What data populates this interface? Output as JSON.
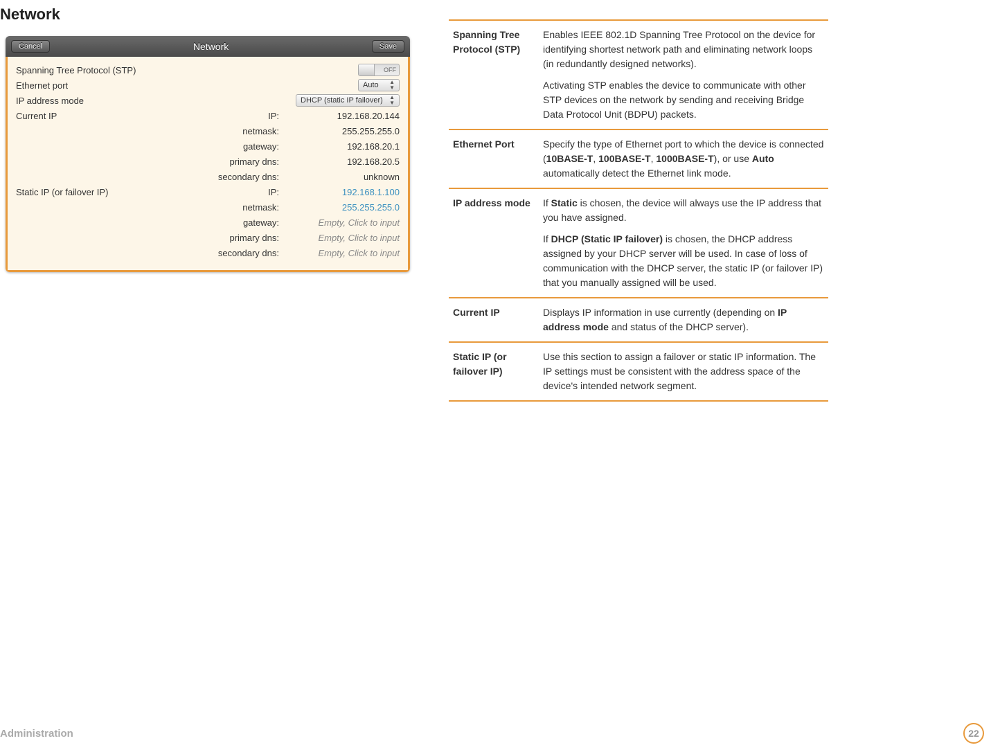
{
  "page": {
    "title": "Network",
    "footer": "Administration",
    "pageNumber": "22"
  },
  "window": {
    "title": "Network",
    "cancel": "Cancel",
    "save": "Save",
    "rows": {
      "stp": {
        "label": "Spanning Tree Protocol (STP)",
        "toggle": "OFF"
      },
      "ethernet": {
        "label": "Ethernet port",
        "value": "Auto"
      },
      "ipmode": {
        "label": "IP address mode",
        "value": "DHCP (static IP failover)"
      },
      "current": {
        "label": "Current IP",
        "ip_lbl": "IP:",
        "ip_val": "192.168.20.144",
        "nm_lbl": "netmask:",
        "nm_val": "255.255.255.0",
        "gw_lbl": "gateway:",
        "gw_val": "192.168.20.1",
        "pd_lbl": "primary dns:",
        "pd_val": "192.168.20.5",
        "sd_lbl": "secondary dns:",
        "sd_val": "unknown"
      },
      "static": {
        "label": "Static IP (or failover IP)",
        "ip_lbl": "IP:",
        "ip_val": "192.168.1.100",
        "nm_lbl": "netmask:",
        "nm_val": "255.255.255.0",
        "gw_lbl": "gateway:",
        "gw_val": "Empty, Click to input",
        "pd_lbl": "primary dns:",
        "pd_val": "Empty, Click to input",
        "sd_lbl": "secondary dns:",
        "sd_val": "Empty, Click to input"
      }
    }
  },
  "defs": {
    "stp": {
      "term": "Spanning Tree Protocol (STP)",
      "p1": "Enables IEEE 802.1D Spanning Tree Protocol on the device for identifying shortest network path and eliminating network loops (in redundantly designed networks).",
      "p2": "Activating STP enables the device to communicate with other STP devices on the network by sending and receiving Bridge Data Protocol Unit (BDPU) packets."
    },
    "eth": {
      "term": "Ethernet Port",
      "p1a": "Specify the type of Ethernet port to which the device is connected (",
      "b1": "10BASE-T",
      "c1": ", ",
      "b2": "100BASE-T",
      "c2": ", ",
      "b3": "1000BASE-T",
      "p1b": "), or use ",
      "b4": "Auto",
      "p1c": " automatically detect the Ethernet link mode."
    },
    "ipmode": {
      "term": "IP address mode",
      "p1a": "If ",
      "b1": "Static",
      "p1b": " is chosen, the device will always use the IP address that you have assigned.",
      "p2a": "If ",
      "b2": "DHCP (Static IP failover)",
      "p2b": " is chosen, the DHCP address assigned by your DHCP server will be used. In case of loss of communication with the DHCP server, the static IP (or failover IP) that you manually assigned will be used."
    },
    "current": {
      "term": "Current IP",
      "p1a": "Displays IP information in use currently (depending on ",
      "b1": "IP address mode",
      "p1b": " and status of the DHCP server)."
    },
    "static": {
      "term": "Static IP (or failover IP)",
      "p1": "Use this section to assign a failover or static IP information. The IP settings must be consistent with the address space of the device's intended network segment."
    }
  }
}
